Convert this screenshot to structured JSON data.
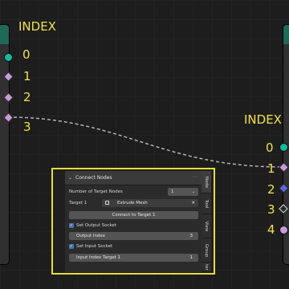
{
  "left_node": {
    "title": "INDEX",
    "outputs": [
      "0",
      "1",
      "2",
      "3"
    ]
  },
  "right_node": {
    "title": "INDEX",
    "inputs": [
      "0",
      "1",
      "2",
      "3",
      "4"
    ]
  },
  "panel": {
    "header": "Connect Nodes",
    "num_targets_label": "Number of Target Nodes",
    "num_targets_value": "1",
    "target1_label": "Target 1",
    "target1_value": "Extrude Mesh",
    "connect_button": "Connect to Target 1",
    "set_output_label": "Set Output Socket",
    "output_index_label": "Output Index",
    "output_index_value": "3",
    "set_input_label": "Set Input Socket",
    "input_index_label": "Input Index Target 1",
    "input_index_value": "1"
  },
  "tabs": [
    "Node",
    "Tool",
    "View",
    "Group",
    "ter"
  ],
  "colors": {
    "highlight": "#e8dc3a",
    "label": "#f0e04a",
    "socket_teal": "#18b8a0",
    "socket_pink": "#c79bd6",
    "socket_blue": "#5d67d6"
  }
}
